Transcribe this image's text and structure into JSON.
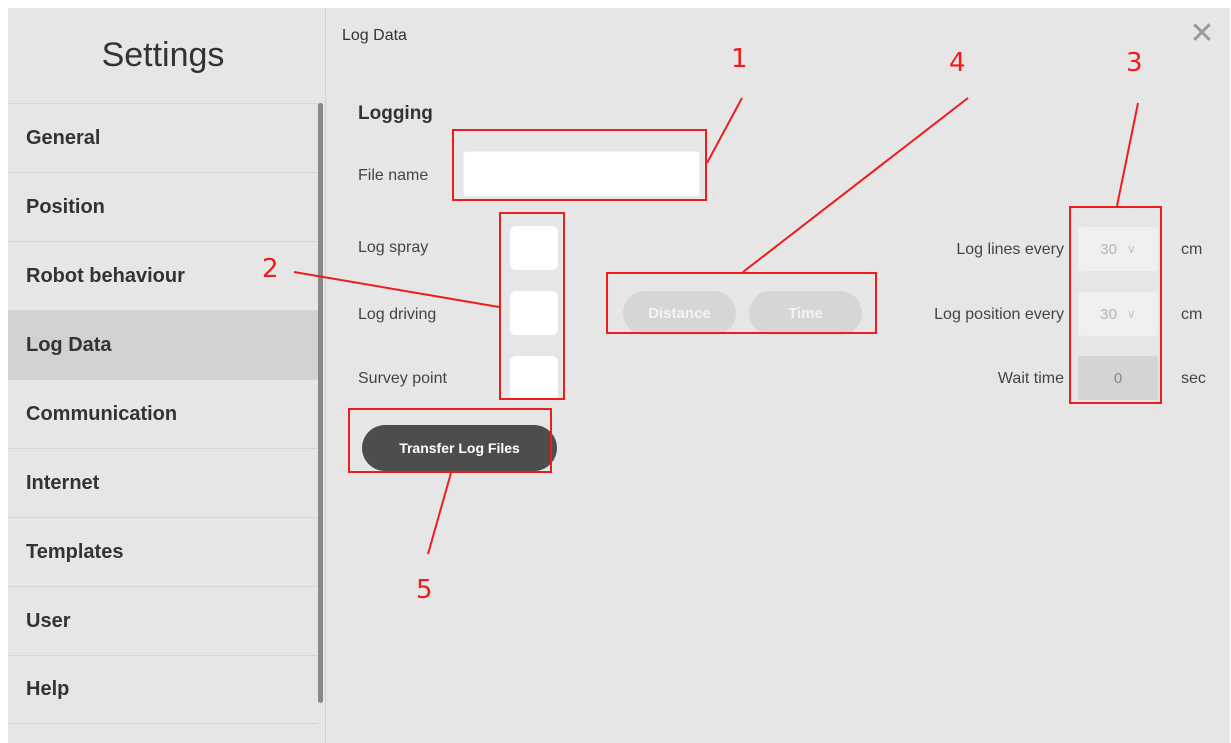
{
  "sidebar": {
    "title": "Settings",
    "items": [
      {
        "label": "General"
      },
      {
        "label": "Position"
      },
      {
        "label": "Robot behaviour"
      },
      {
        "label": "Log Data"
      },
      {
        "label": "Communication"
      },
      {
        "label": "Internet"
      },
      {
        "label": "Templates"
      },
      {
        "label": "User"
      },
      {
        "label": "Help"
      }
    ],
    "active": "Log Data"
  },
  "main": {
    "breadcrumb": "Log Data",
    "close_icon": "close-icon",
    "section_title": "Logging",
    "file_name": {
      "label": "File name",
      "value": ""
    },
    "checkboxes": [
      {
        "label": "Log spray",
        "checked": false
      },
      {
        "label": "Log driving",
        "checked": false
      },
      {
        "label": "Survey point",
        "checked": false
      }
    ],
    "mode_toggle": {
      "options": [
        "Distance",
        "Time"
      ]
    },
    "transfer_button": "Transfer Log Files",
    "intervals": [
      {
        "label": "Log lines every",
        "value": "30",
        "unit": "cm"
      },
      {
        "label": "Log position every",
        "value": "30",
        "unit": "cm"
      },
      {
        "label": "Wait time",
        "value": "0",
        "unit": "sec"
      }
    ]
  },
  "annotations": {
    "color": "#ee1c1c",
    "numbers": [
      "1",
      "2",
      "3",
      "4",
      "5"
    ]
  }
}
